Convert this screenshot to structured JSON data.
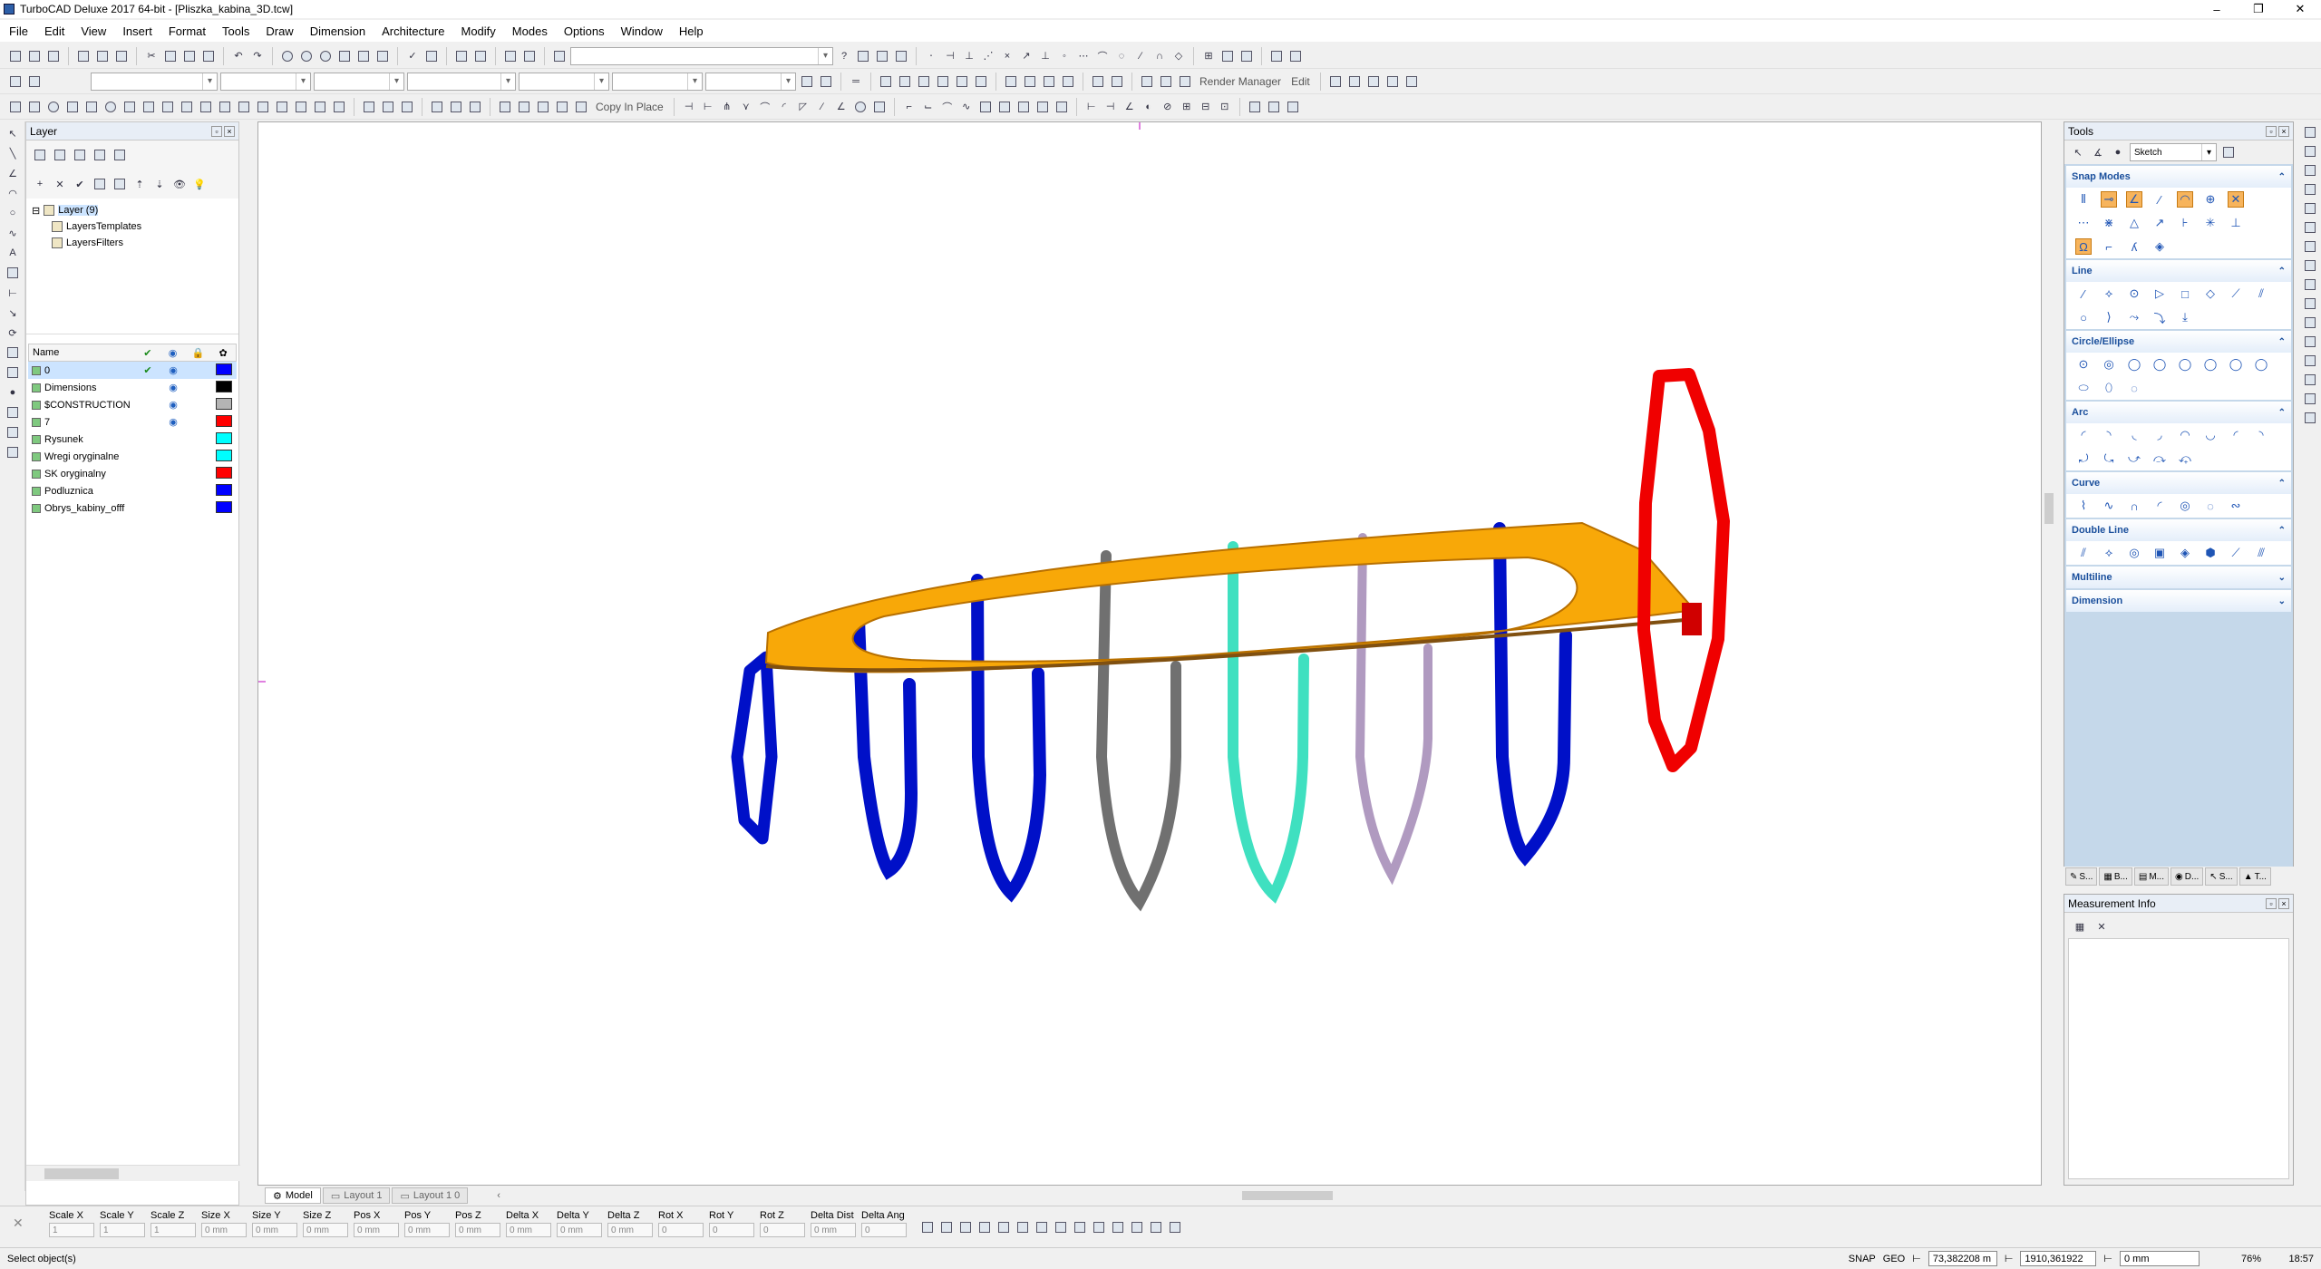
{
  "window": {
    "title": "TurboCAD Deluxe 2017 64-bit - [Pliszka_kabina_3D.tcw]",
    "controls": [
      "–",
      "❐",
      "✕"
    ]
  },
  "menu": [
    "File",
    "Edit",
    "View",
    "Insert",
    "Format",
    "Tools",
    "Draw",
    "Dimension",
    "Architecture",
    "Modify",
    "Modes",
    "Options",
    "Window",
    "Help"
  ],
  "toolbar": {
    "copy_in_place": "Copy In Place",
    "render_manager": "Render Manager",
    "edit": "Edit"
  },
  "layer_panel": {
    "title": "Layer",
    "tree": {
      "root": "Layer (9)",
      "children": [
        "LayersTemplates",
        "LayersFilters"
      ]
    },
    "columns": {
      "name": "Name"
    },
    "layers": [
      {
        "name": "0",
        "check": "✔",
        "eye": "◉",
        "color": "#0000ff",
        "selected": true
      },
      {
        "name": "Dimensions",
        "check": "",
        "eye": "◉",
        "color": "#000000"
      },
      {
        "name": "$CONSTRUCTION",
        "check": "",
        "eye": "◉",
        "color": "#b4b4b4"
      },
      {
        "name": "7",
        "check": "",
        "eye": "◉",
        "color": "#ff0000"
      },
      {
        "name": "Rysunek",
        "check": "",
        "eye": "",
        "color": "#00ffff"
      },
      {
        "name": "Wregi oryginalne",
        "check": "",
        "eye": "",
        "color": "#00ffff"
      },
      {
        "name": "SK oryginalny",
        "check": "",
        "eye": "",
        "color": "#ff0000"
      },
      {
        "name": "Podluznica",
        "check": "",
        "eye": "",
        "color": "#0000ff"
      },
      {
        "name": "Obrys_kabiny_offf",
        "check": "",
        "eye": "",
        "color": "#0000ff"
      }
    ]
  },
  "tabs": {
    "model": "Model",
    "layout1": "Layout 1",
    "layout10": "Layout 1 0"
  },
  "inspector": {
    "fields": [
      {
        "label": "Scale X",
        "value": "1"
      },
      {
        "label": "Scale Y",
        "value": "1"
      },
      {
        "label": "Scale Z",
        "value": "1"
      },
      {
        "label": "Size X",
        "value": "0 mm"
      },
      {
        "label": "Size Y",
        "value": "0 mm"
      },
      {
        "label": "Size Z",
        "value": "0 mm"
      },
      {
        "label": "Pos X",
        "value": "0 mm"
      },
      {
        "label": "Pos Y",
        "value": "0 mm"
      },
      {
        "label": "Pos Z",
        "value": "0 mm"
      },
      {
        "label": "Delta X",
        "value": "0 mm"
      },
      {
        "label": "Delta Y",
        "value": "0 mm"
      },
      {
        "label": "Delta Z",
        "value": "0 mm"
      },
      {
        "label": "Rot X",
        "value": "0"
      },
      {
        "label": "Rot Y",
        "value": "0"
      },
      {
        "label": "Rot Z",
        "value": "0"
      },
      {
        "label": "Delta Dist",
        "value": "0 mm"
      },
      {
        "label": "Delta Ang",
        "value": "0"
      }
    ]
  },
  "status": {
    "prompt": "Select object(s)",
    "snap": "SNAP",
    "geo": "GEO",
    "x": "73,382208 m",
    "y": "1910,361922",
    "z": "0 mm",
    "zoom": "76%",
    "time": "18:57"
  },
  "tools_panel": {
    "title": "Tools",
    "mode": "Sketch",
    "sections": [
      {
        "name": "Snap Modes",
        "open": true
      },
      {
        "name": "Line",
        "open": true
      },
      {
        "name": "Circle/Ellipse",
        "open": true
      },
      {
        "name": "Arc",
        "open": true
      },
      {
        "name": "Curve",
        "open": true
      },
      {
        "name": "Double Line",
        "open": true
      },
      {
        "name": "Multiline",
        "open": false
      },
      {
        "name": "Dimension",
        "open": false
      }
    ],
    "tabs": [
      "S...",
      "B...",
      "M...",
      "D...",
      "S...",
      "T..."
    ]
  },
  "measurement_panel": {
    "title": "Measurement Info"
  }
}
